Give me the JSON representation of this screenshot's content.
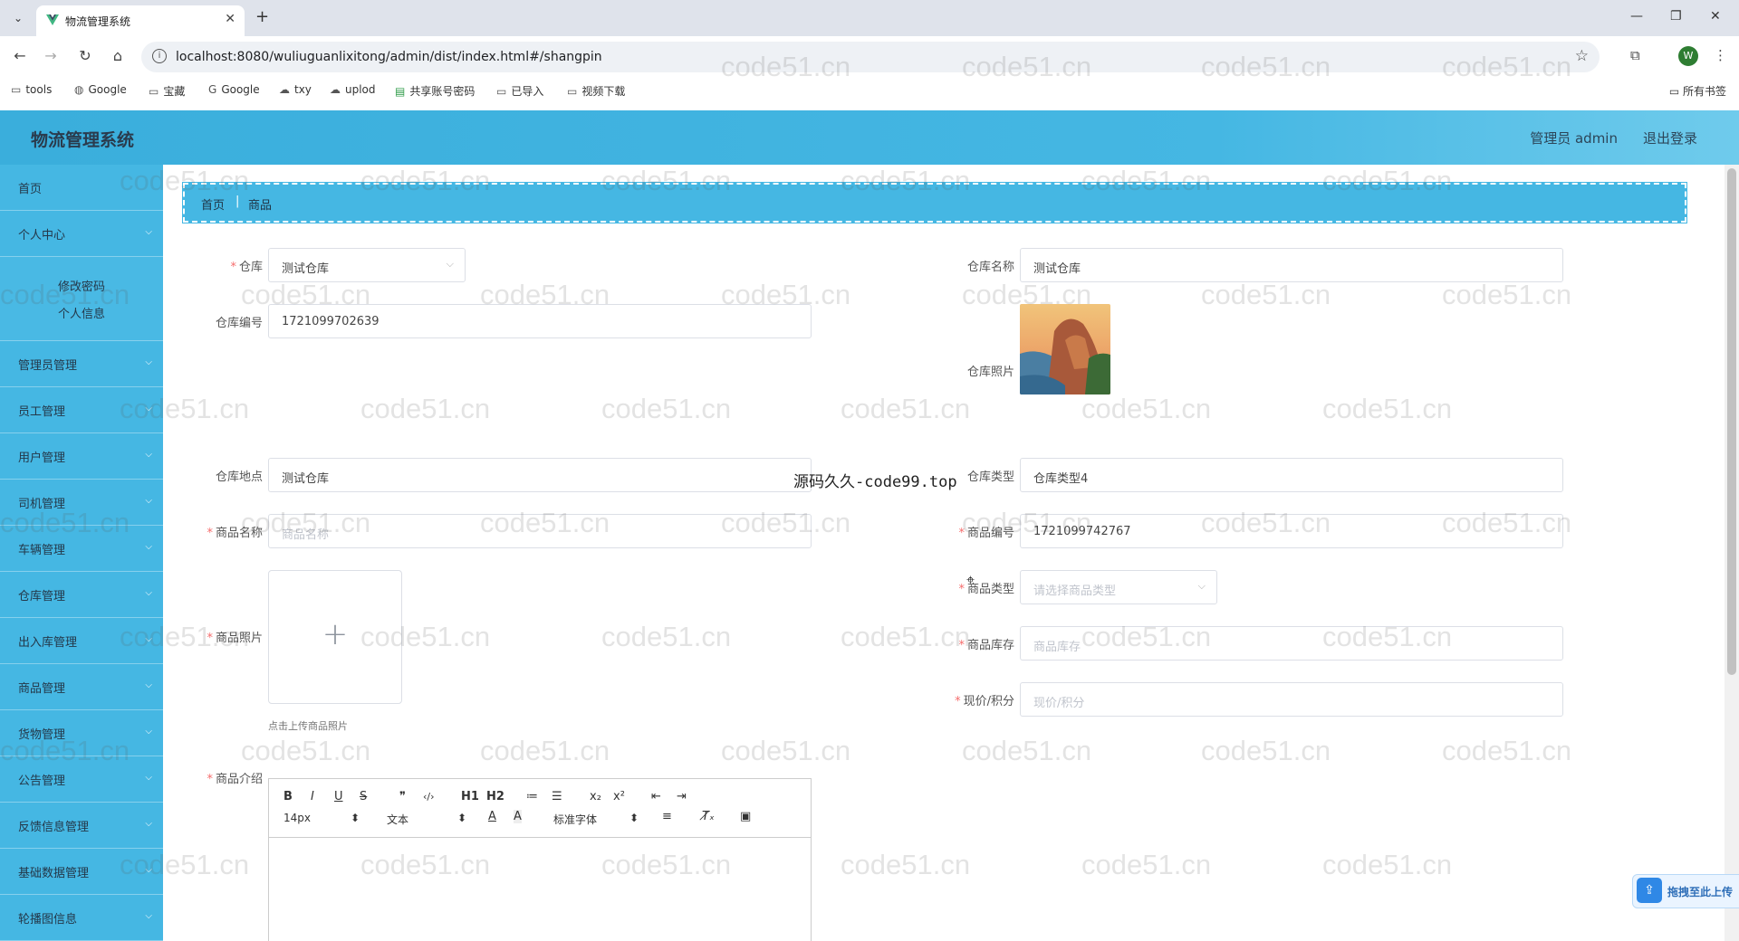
{
  "browser": {
    "tab_title": "物流管理系统",
    "url": "localhost:8080/wuliuguanlixitong/admin/dist/index.html#/shangpin",
    "avatar_letter": "W",
    "bookmarks": [
      "tools",
      "Google",
      "宝藏",
      "Google",
      "txy",
      "uplod",
      "共享账号密码",
      "已导入",
      "视频下载"
    ],
    "all_bookmarks": "所有书签"
  },
  "header": {
    "title": "物流管理系统",
    "user": "管理员 admin",
    "logout": "退出登录"
  },
  "sidebar": {
    "items": [
      {
        "label": "首页"
      },
      {
        "label": "个人中心"
      },
      {
        "label": "管理员管理"
      },
      {
        "label": "员工管理"
      },
      {
        "label": "用户管理"
      },
      {
        "label": "司机管理"
      },
      {
        "label": "车辆管理"
      },
      {
        "label": "仓库管理"
      },
      {
        "label": "出入库管理"
      },
      {
        "label": "商品管理"
      },
      {
        "label": "货物管理"
      },
      {
        "label": "公告管理"
      },
      {
        "label": "反馈信息管理"
      },
      {
        "label": "基础数据管理"
      },
      {
        "label": "轮播图信息"
      }
    ],
    "sub_items": [
      "修改密码",
      "个人信息"
    ]
  },
  "breadcrumb": {
    "home": "首页",
    "current": "商品"
  },
  "form": {
    "warehouse": {
      "label": "仓库",
      "value": "测试仓库"
    },
    "warehouse_name": {
      "label": "仓库名称",
      "value": "测试仓库"
    },
    "warehouse_code": {
      "label": "仓库编号",
      "value": "1721099702639"
    },
    "warehouse_photo": {
      "label": "仓库照片"
    },
    "warehouse_location": {
      "label": "仓库地点",
      "value": "测试仓库"
    },
    "warehouse_type": {
      "label": "仓库类型",
      "value": "仓库类型4"
    },
    "product_name": {
      "label": "商品名称",
      "placeholder": "商品名称"
    },
    "product_code": {
      "label": "商品编号",
      "value": "1721099742767"
    },
    "product_type": {
      "label": "商品类型",
      "placeholder": "请选择商品类型"
    },
    "product_photo": {
      "label": "商品照片",
      "hint": "点击上传商品照片"
    },
    "product_stock": {
      "label": "商品库存",
      "placeholder": "商品库存"
    },
    "price_points": {
      "label": "现价/积分",
      "placeholder": "现价/积分"
    },
    "product_intro": {
      "label": "商品介绍"
    }
  },
  "editor": {
    "font_size": "14px",
    "format": "文本",
    "font_family": "标准字体",
    "buttons": [
      "B",
      "I",
      "U",
      "S",
      "❞",
      "‹/›",
      "H1",
      "H2",
      "≔",
      "☰",
      "x₂",
      "x²"
    ]
  },
  "overlay": {
    "center_watermark": "源码久久-code99.top",
    "watermark": "code51.cn",
    "upload_float": "拖拽至此上传"
  },
  "colors": {
    "primary": "#45b7e3",
    "required": "#f56c6c"
  }
}
